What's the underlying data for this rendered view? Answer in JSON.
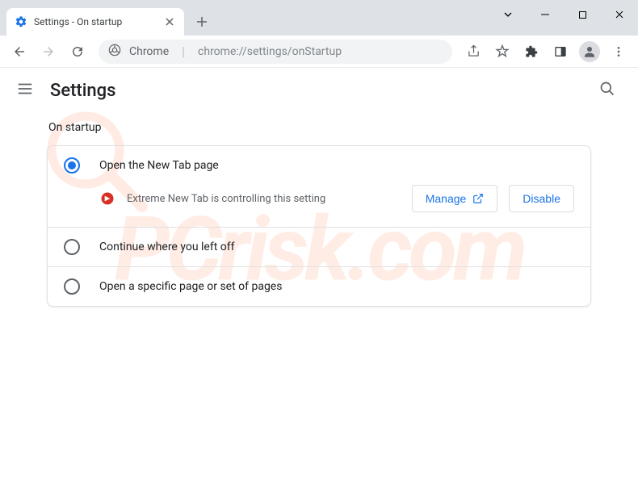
{
  "tab": {
    "title": "Settings - On startup"
  },
  "omnibox": {
    "scheme_label": "Chrome",
    "url": "chrome://settings/onStartup"
  },
  "header": {
    "title": "Settings"
  },
  "section": {
    "title": "On startup"
  },
  "options": {
    "new_tab_label": "Open the New Tab page",
    "continue_label": "Continue where you left off",
    "specific_label": "Open a specific page or set of pages"
  },
  "extension": {
    "message": "Extreme New Tab is controlling this setting",
    "manage_label": "Manage",
    "disable_label": "Disable"
  },
  "watermark": {
    "text": "PCrisk.com"
  }
}
